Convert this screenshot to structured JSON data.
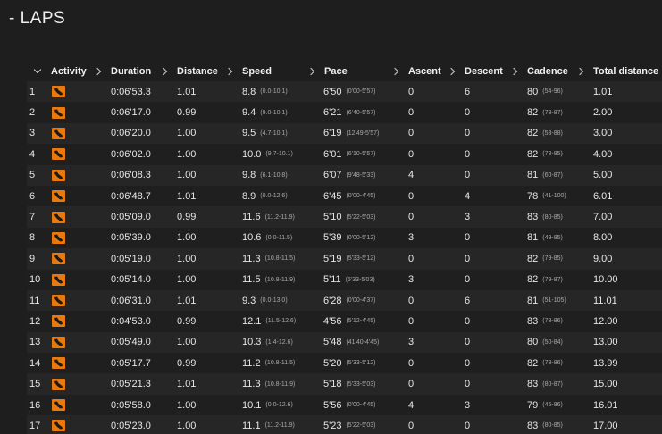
{
  "section": {
    "title": "- LAPS"
  },
  "columns": {
    "activity": "Activity",
    "duration": "Duration",
    "distance": "Distance",
    "speed": "Speed",
    "pace": "Pace",
    "ascent": "Ascent",
    "descent": "Descent",
    "cadence": "Cadence",
    "total_distance": "Total distance"
  },
  "icons": {
    "collapse": "chevron-down-icon",
    "sort": "chevron-right-icon",
    "activity": "running-shoe-icon"
  },
  "colors": {
    "activity_icon": "#e8790f",
    "background": "#1e1e1e"
  },
  "laps": [
    {
      "idx": "1",
      "duration": "0:06'53.3",
      "distance": "1.01",
      "speed": "8.8",
      "speed_range": "(0.0-10.1)",
      "pace": "6'50",
      "pace_range": "(0'00-5'57)",
      "ascent": "0",
      "descent": "6",
      "cadence": "80",
      "cadence_range": "(54-96)",
      "total": "1.01"
    },
    {
      "idx": "2",
      "duration": "0:06'17.0",
      "distance": "0.99",
      "speed": "9.4",
      "speed_range": "(9.0-10.1)",
      "pace": "6'21",
      "pace_range": "(6'40-5'57)",
      "ascent": "0",
      "descent": "0",
      "cadence": "82",
      "cadence_range": "(78-87)",
      "total": "2.00"
    },
    {
      "idx": "3",
      "duration": "0:06'20.0",
      "distance": "1.00",
      "speed": "9.5",
      "speed_range": "(4.7-10.1)",
      "pace": "6'19",
      "pace_range": "(12'49-5'57)",
      "ascent": "0",
      "descent": "0",
      "cadence": "82",
      "cadence_range": "(53-88)",
      "total": "3.00"
    },
    {
      "idx": "4",
      "duration": "0:06'02.0",
      "distance": "1.00",
      "speed": "10.0",
      "speed_range": "(9.7-10.1)",
      "pace": "6'01",
      "pace_range": "(6'10-5'57)",
      "ascent": "0",
      "descent": "0",
      "cadence": "82",
      "cadence_range": "(78-85)",
      "total": "4.00"
    },
    {
      "idx": "5",
      "duration": "0:06'08.3",
      "distance": "1.00",
      "speed": "9.8",
      "speed_range": "(6.1-10.8)",
      "pace": "6'07",
      "pace_range": "(9'48-5'33)",
      "ascent": "4",
      "descent": "0",
      "cadence": "81",
      "cadence_range": "(60-87)",
      "total": "5.00"
    },
    {
      "idx": "6",
      "duration": "0:06'48.7",
      "distance": "1.01",
      "speed": "8.9",
      "speed_range": "(0.0-12.6)",
      "pace": "6'45",
      "pace_range": "(0'00-4'45)",
      "ascent": "0",
      "descent": "4",
      "cadence": "78",
      "cadence_range": "(41-100)",
      "total": "6.01"
    },
    {
      "idx": "7",
      "duration": "0:05'09.0",
      "distance": "0.99",
      "speed": "11.6",
      "speed_range": "(11.2-11.9)",
      "pace": "5'10",
      "pace_range": "(5'22-5'03)",
      "ascent": "0",
      "descent": "3",
      "cadence": "83",
      "cadence_range": "(80-85)",
      "total": "7.00"
    },
    {
      "idx": "8",
      "duration": "0:05'39.0",
      "distance": "1.00",
      "speed": "10.6",
      "speed_range": "(0.0-11.5)",
      "pace": "5'39",
      "pace_range": "(0'00-5'12)",
      "ascent": "3",
      "descent": "0",
      "cadence": "81",
      "cadence_range": "(49-85)",
      "total": "8.00"
    },
    {
      "idx": "9",
      "duration": "0:05'19.0",
      "distance": "1.00",
      "speed": "11.3",
      "speed_range": "(10.8-11.5)",
      "pace": "5'19",
      "pace_range": "(5'33-5'12)",
      "ascent": "0",
      "descent": "0",
      "cadence": "82",
      "cadence_range": "(79-85)",
      "total": "9.00"
    },
    {
      "idx": "10",
      "duration": "0:05'14.0",
      "distance": "1.00",
      "speed": "11.5",
      "speed_range": "(10.8-11.9)",
      "pace": "5'11",
      "pace_range": "(5'33-5'03)",
      "ascent": "3",
      "descent": "0",
      "cadence": "82",
      "cadence_range": "(79-87)",
      "total": "10.00"
    },
    {
      "idx": "11",
      "duration": "0:06'31.0",
      "distance": "1.01",
      "speed": "9.3",
      "speed_range": "(0.0-13.0)",
      "pace": "6'28",
      "pace_range": "(0'00-4'37)",
      "ascent": "0",
      "descent": "6",
      "cadence": "81",
      "cadence_range": "(51-105)",
      "total": "11.01"
    },
    {
      "idx": "12",
      "duration": "0:04'53.0",
      "distance": "0.99",
      "speed": "12.1",
      "speed_range": "(11.5-12.6)",
      "pace": "4'56",
      "pace_range": "(5'12-4'45)",
      "ascent": "0",
      "descent": "0",
      "cadence": "83",
      "cadence_range": "(78-86)",
      "total": "12.00"
    },
    {
      "idx": "13",
      "duration": "0:05'49.0",
      "distance": "1.00",
      "speed": "10.3",
      "speed_range": "(1.4-12.6)",
      "pace": "5'48",
      "pace_range": "(41'40-4'45)",
      "ascent": "3",
      "descent": "0",
      "cadence": "80",
      "cadence_range": "(50-84)",
      "total": "13.00"
    },
    {
      "idx": "14",
      "duration": "0:05'17.7",
      "distance": "0.99",
      "speed": "11.2",
      "speed_range": "(10.8-11.5)",
      "pace": "5'20",
      "pace_range": "(5'33-5'12)",
      "ascent": "0",
      "descent": "0",
      "cadence": "82",
      "cadence_range": "(78-86)",
      "total": "13.99"
    },
    {
      "idx": "15",
      "duration": "0:05'21.3",
      "distance": "1.01",
      "speed": "11.3",
      "speed_range": "(10.8-11.9)",
      "pace": "5'18",
      "pace_range": "(5'33-5'03)",
      "ascent": "0",
      "descent": "0",
      "cadence": "83",
      "cadence_range": "(80-87)",
      "total": "15.00"
    },
    {
      "idx": "16",
      "duration": "0:05'58.0",
      "distance": "1.00",
      "speed": "10.1",
      "speed_range": "(0.0-12.6)",
      "pace": "5'56",
      "pace_range": "(0'00-4'45)",
      "ascent": "4",
      "descent": "3",
      "cadence": "79",
      "cadence_range": "(45-86)",
      "total": "16.01"
    },
    {
      "idx": "17",
      "duration": "0:05'23.0",
      "distance": "1.00",
      "speed": "11.1",
      "speed_range": "(11.2-11.9)",
      "pace": "5'23",
      "pace_range": "(5'22-5'03)",
      "ascent": "0",
      "descent": "0",
      "cadence": "83",
      "cadence_range": "(80-85)",
      "total": "17.00"
    }
  ]
}
